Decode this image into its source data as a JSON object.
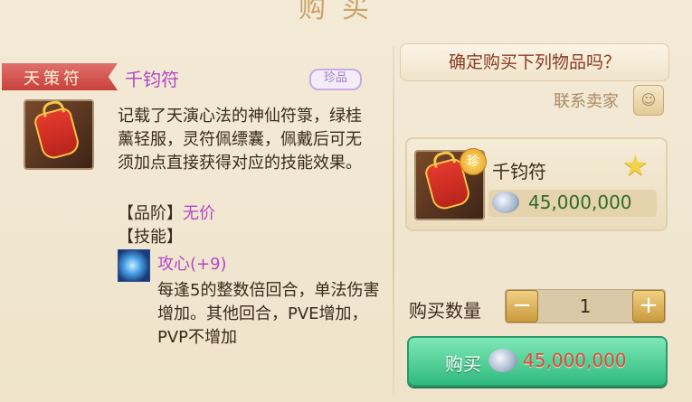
{
  "header": {
    "title": "购买",
    "scroll_text": "…………………………………………………"
  },
  "item": {
    "category": "天策符",
    "name": "千钧符",
    "rarity": "珍品",
    "description": "记载了天演心法的神仙符箓，绿桂薰轻服，灵符佩缥囊，佩戴后可无须加点直接获得对应的技能效果。",
    "grade_label": "【品阶】",
    "grade_value": "无价",
    "skill_label": "【技能】",
    "skill_name": "攻心(+9)",
    "skill_desc": "每逢5的整数倍回合，单法伤害增加。其他回合，PVE增加，PVP不增加"
  },
  "purchase": {
    "confirm_text": "确定购买下列物品吗？",
    "contact_label": "联系卖家",
    "contact_icon": "person-icon",
    "card_item_name": "千钧符",
    "badge": "珍",
    "price": "45,000,000",
    "qty_label": "购买数量",
    "qty_value": "1",
    "minus": "−",
    "plus": "+",
    "buy_label": "购买",
    "buy_price": "45,000,000"
  },
  "colors": {
    "accent_purple": "#b447c7",
    "buy_green": "#2fba7f",
    "price_red": "#e0473d",
    "price_green": "#2e6b2a"
  }
}
